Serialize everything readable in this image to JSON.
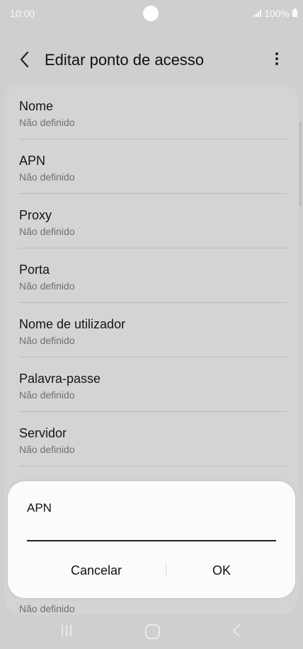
{
  "status_bar": {
    "time": "10:00",
    "battery": "100%"
  },
  "app_bar": {
    "title": "Editar ponto de acesso",
    "back_icon": "chevron-left-icon",
    "more_icon": "more-vertical-icon"
  },
  "settings": {
    "items": [
      {
        "label": "Nome",
        "value": "Não definido"
      },
      {
        "label": "APN",
        "value": "Não definido"
      },
      {
        "label": "Proxy",
        "value": "Não definido"
      },
      {
        "label": "Porta",
        "value": "Não definido"
      },
      {
        "label": "Nome de utilizador",
        "value": "Não definido"
      },
      {
        "label": "Palavra-passe",
        "value": "Não definido"
      },
      {
        "label": "Servidor",
        "value": "Não definido"
      }
    ],
    "partial_value": "Não definido"
  },
  "dialog": {
    "title": "APN",
    "input_value": "",
    "cancel_label": "Cancelar",
    "ok_label": "OK"
  },
  "nav_bar": {
    "recent_icon": "recent-apps-icon",
    "home_icon": "home-icon",
    "back_icon": "back-icon"
  },
  "colors": {
    "background": "#cfcfcf",
    "dialog": "#fbfbfb",
    "text": "#111111",
    "secondary_text": "#6f6f6f"
  }
}
